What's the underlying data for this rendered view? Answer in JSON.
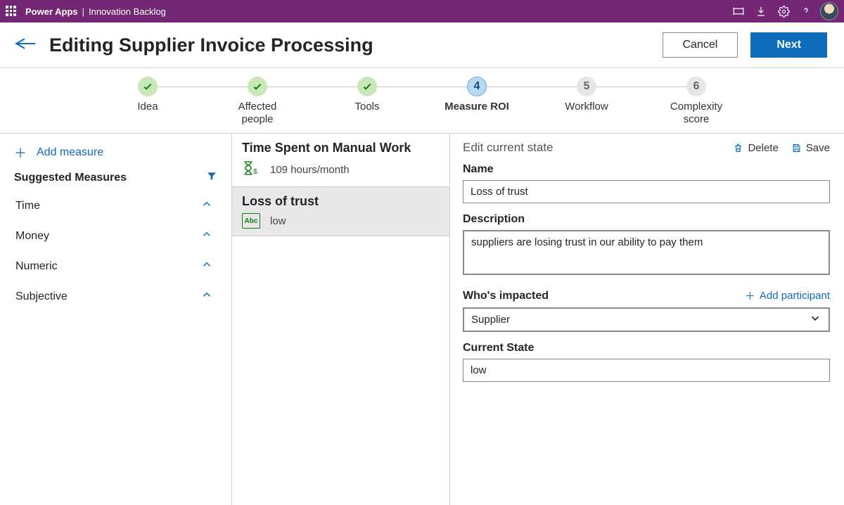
{
  "topbar": {
    "app": "Power Apps",
    "sep": "|",
    "page": "Innovation Backlog"
  },
  "header": {
    "title": "Editing Supplier Invoice Processing",
    "cancel": "Cancel",
    "next": "Next"
  },
  "stepper": [
    {
      "label": "Idea",
      "state": "done"
    },
    {
      "label": "Affected people",
      "state": "done"
    },
    {
      "label": "Tools",
      "state": "done"
    },
    {
      "label": "Measure ROI",
      "state": "current",
      "num": "4"
    },
    {
      "label": "Workflow",
      "state": "future",
      "num": "5"
    },
    {
      "label": "Complexity score",
      "state": "future",
      "num": "6"
    }
  ],
  "left": {
    "add": "Add measure",
    "filter_label": "Suggested Measures",
    "categories": [
      "Time",
      "Money",
      "Numeric",
      "Subjective"
    ]
  },
  "mid": [
    {
      "title": "Time Spent on Manual Work",
      "value": "109 hours/month",
      "icon": "hourglass",
      "selected": false
    },
    {
      "title": "Loss of trust",
      "value": "low",
      "icon": "abc",
      "selected": true
    }
  ],
  "right": {
    "title": "Edit current state",
    "delete": "Delete",
    "save": "Save",
    "name_label": "Name",
    "name_value": "Loss of trust",
    "desc_label": "Description",
    "desc_value": "suppliers are losing trust in our ability to pay them",
    "impacted_label": "Who's impacted",
    "add_participant": "Add participant",
    "impacted_value": "Supplier",
    "state_label": "Current State",
    "state_value": "low"
  }
}
